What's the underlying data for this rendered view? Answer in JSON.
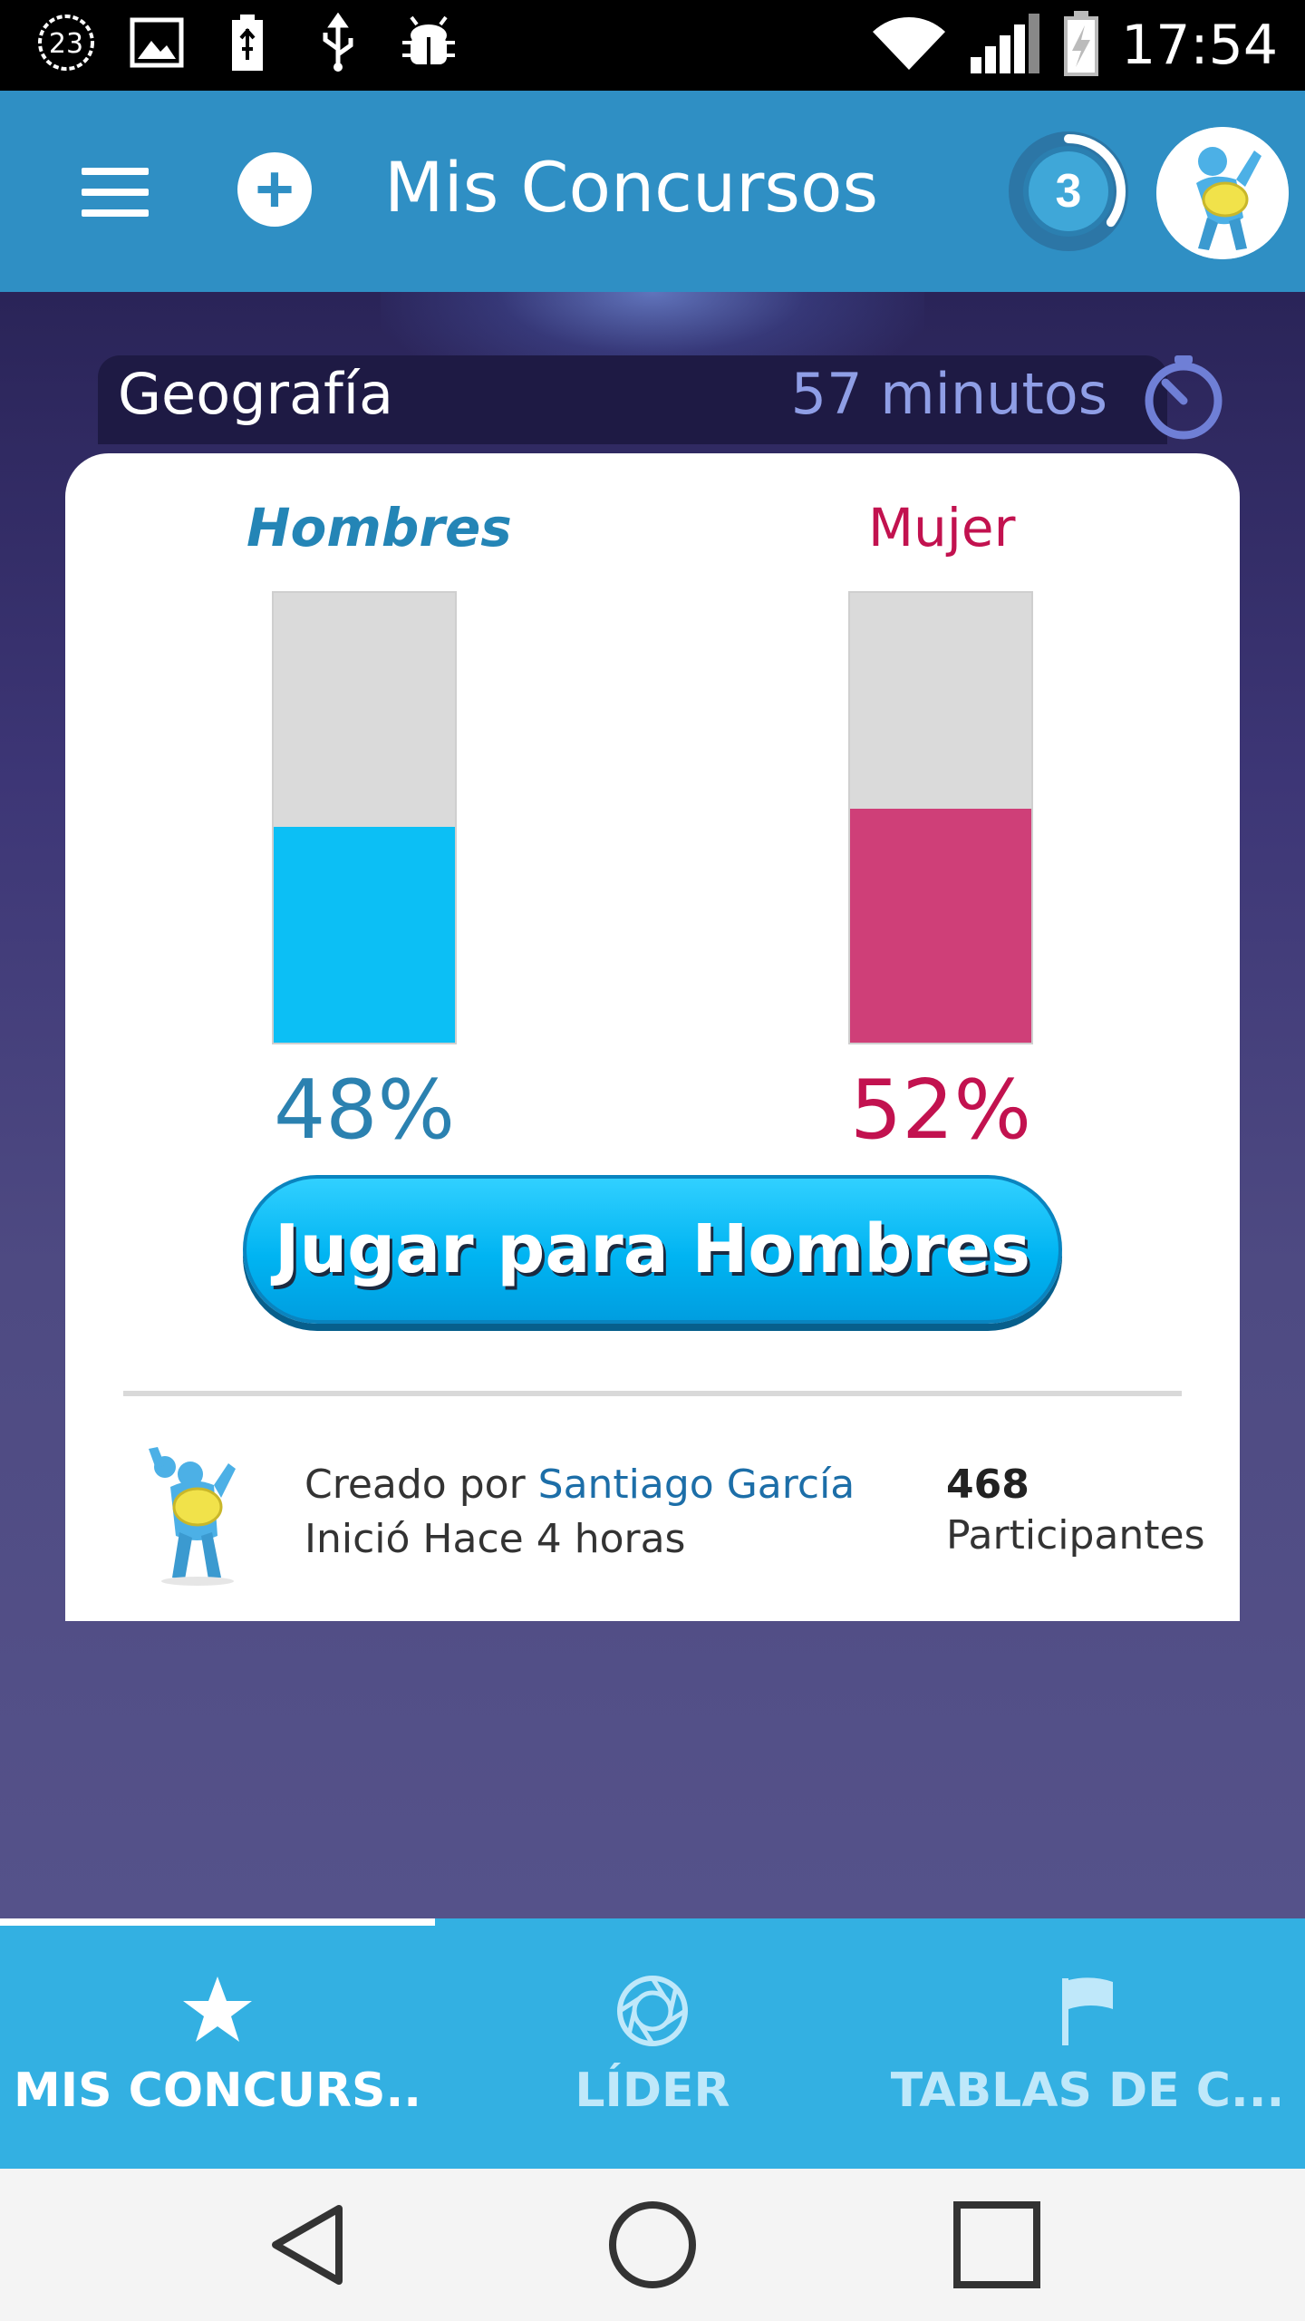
{
  "status_bar": {
    "notification_count": "23",
    "time": "17:54"
  },
  "app_bar": {
    "title": "Mis Concursos",
    "level": "3",
    "level_progress": 0.35
  },
  "contest": {
    "topic": "Geografía",
    "time_left": "57 minutos",
    "men": {
      "label": "Hombres",
      "percent_label": "48%",
      "percent": 48
    },
    "women": {
      "label": "Mujer",
      "percent_label": "52%",
      "percent": 52
    },
    "play_button_label": "Jugar para Hombres",
    "created_by_prefix": "Creado por ",
    "creator_name": "Santiago García",
    "started": "Inició Hace 4 horas",
    "participants_count": "468",
    "participants_label": "Participantes"
  },
  "tabs": [
    {
      "label": "MIS CONCURS..",
      "icon": "star-icon",
      "active": true
    },
    {
      "label": "LÍDER",
      "icon": "aperture-icon",
      "active": false
    },
    {
      "label": "TABLAS DE C...",
      "icon": "flag-icon",
      "active": false
    }
  ],
  "colors": {
    "app_bar": "#2f8fc4",
    "men": "#0cbff5",
    "women": "#cf3f78",
    "tab_bar": "#33b0e2"
  }
}
